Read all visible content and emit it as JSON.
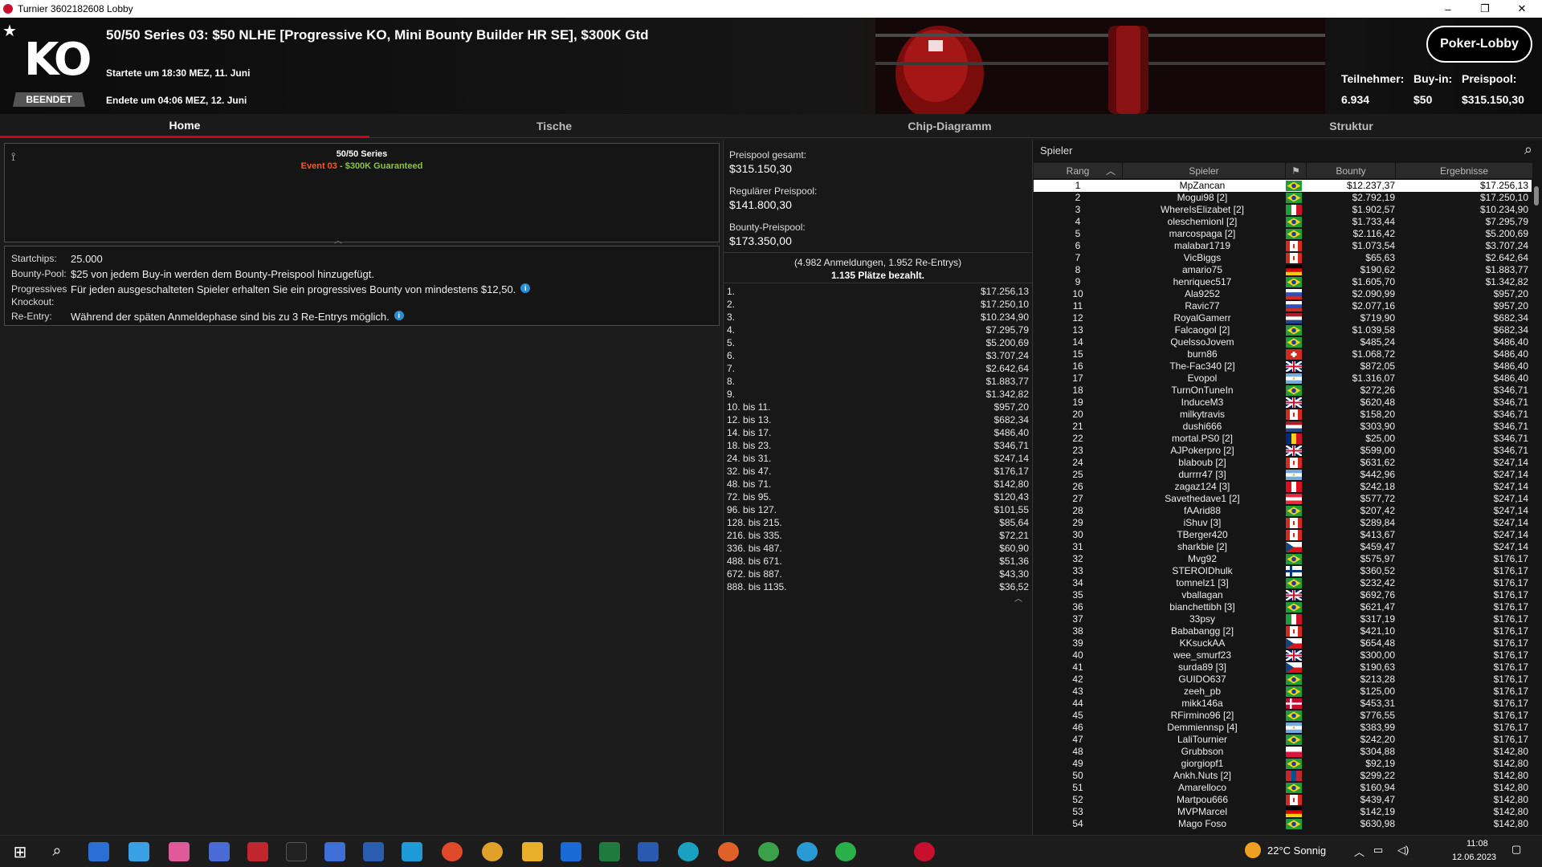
{
  "window": {
    "title": "Turnier 3602182608 Lobby"
  },
  "header": {
    "status_badge": "BEENDET",
    "title": "50/50 Series 03: $50 NLHE [Progressive KO, Mini Bounty Builder HR SE], $300K Gtd",
    "start": "Startete um 18:30 MEZ, 11. Juni",
    "end": "Endete um 04:06 MEZ, 12. Juni",
    "lobby_button": "Poker-Lobby",
    "participants_label": "Teilnehmer:",
    "participants": "6.934",
    "buyin_label": "Buy-in:",
    "buyin": "$50",
    "prizepool_label": "Preispool:",
    "prizepool": "$315.150,30"
  },
  "tabs": [
    "Home",
    "Tische",
    "Chip-Diagramm",
    "Struktur"
  ],
  "series": {
    "title": "50/50 Series",
    "event": "Event 03",
    "dash": " - ",
    "guaranteed": "$300K Guaranteed"
  },
  "details": [
    {
      "k": "Startchips:",
      "v": "25.000",
      "info": false
    },
    {
      "k": "Bounty-Pool:",
      "v": "$25 von jedem Buy-in werden dem Bounty-Preispool hinzugefügt.",
      "info": false
    },
    {
      "k": "Progressives",
      "v": "Für jeden ausgeschalteten Spieler erhalten Sie ein progressives Bounty von mindestens $12,50.",
      "info": true
    },
    {
      "k": "Knockout:",
      "v": "",
      "info": false
    },
    {
      "k": "Re-Entry:",
      "v": "Während der späten Anmeldephase sind bis zu 3 Re-Entrys möglich.",
      "info": true
    }
  ],
  "pool": {
    "total_label": "Preispool gesamt:",
    "total": "$315.150,30",
    "regular_label": "Regulärer Preispool:",
    "regular": "$141.800,30",
    "bounty_label": "Bounty-Preispool:",
    "bounty": "$173.350,00",
    "registrations": "(4.982 Anmeldungen, 1.952 Re-Entrys)",
    "paid": "1.135 Plätze bezahlt."
  },
  "payouts": [
    [
      "1.",
      "$17.256,13"
    ],
    [
      "2.",
      "$17.250,10"
    ],
    [
      "3.",
      "$10.234,90"
    ],
    [
      "4.",
      "$7.295,79"
    ],
    [
      "5.",
      "$5.200,69"
    ],
    [
      "6.",
      "$3.707,24"
    ],
    [
      "7.",
      "$2.642,64"
    ],
    [
      "8.",
      "$1.883,77"
    ],
    [
      "9.",
      "$1.342,82"
    ],
    [
      "10. bis 11.",
      "$957,20"
    ],
    [
      "12. bis 13.",
      "$682,34"
    ],
    [
      "14. bis 17.",
      "$486,40"
    ],
    [
      "18. bis 23.",
      "$346,71"
    ],
    [
      "24. bis 31.",
      "$247,14"
    ],
    [
      "32. bis 47.",
      "$176,17"
    ],
    [
      "48. bis 71.",
      "$142,80"
    ],
    [
      "72. bis 95.",
      "$120,43"
    ],
    [
      "96. bis 127.",
      "$101,55"
    ],
    [
      "128. bis 215.",
      "$85,64"
    ],
    [
      "216. bis 335.",
      "$72,21"
    ],
    [
      "336. bis 487.",
      "$60,90"
    ],
    [
      "488. bis 671.",
      "$51,36"
    ],
    [
      "672. bis 887.",
      "$43,30"
    ],
    [
      "888. bis 1135.",
      "$36,52"
    ]
  ],
  "players_panel": {
    "label": "Spieler",
    "col_rank": "Rang",
    "col_player": "Spieler",
    "col_bounty": "Bounty",
    "col_result": "Ergebnisse"
  },
  "players": [
    [
      "1",
      "MpZancan",
      "$12.237,37",
      "$17.256,13",
      "br"
    ],
    [
      "2",
      "Mogui98 [2]",
      "$2.792,19",
      "$17.250,10",
      "br"
    ],
    [
      "3",
      "WhereIsElizabet [2]",
      "$1.902,57",
      "$10.234,90",
      "mx"
    ],
    [
      "4",
      "oleschemionl [2]",
      "$1.733,44",
      "$7.295,79",
      "br"
    ],
    [
      "5",
      "marcospaga [2]",
      "$2.116,42",
      "$5.200,69",
      "br"
    ],
    [
      "6",
      "malabar1719",
      "$1.073,54",
      "$3.707,24",
      "ca"
    ],
    [
      "7",
      "VicBiggs",
      "$65,63",
      "$2.642,64",
      "ca"
    ],
    [
      "8",
      "amario75",
      "$190,62",
      "$1.883,77",
      "de"
    ],
    [
      "9",
      "henriquec517",
      "$1.605,70",
      "$1.342,82",
      "br"
    ],
    [
      "10",
      "Ala9252",
      "$2.090,99",
      "$957,20",
      "ru"
    ],
    [
      "11",
      "Ravic77",
      "$2.077,16",
      "$957,20",
      "ru"
    ],
    [
      "12",
      "RoyalGamerr",
      "$719,90",
      "$682,34",
      "nl"
    ],
    [
      "13",
      "Falcaogol [2]",
      "$1.039,58",
      "$682,34",
      "br"
    ],
    [
      "14",
      "QuelssoJovem",
      "$485,24",
      "$486,40",
      "br"
    ],
    [
      "15",
      "burn86",
      "$1.068,72",
      "$486,40",
      "ch"
    ],
    [
      "16",
      "The-Fac340 [2]",
      "$872,05",
      "$486,40",
      "gb"
    ],
    [
      "17",
      "Evopol",
      "$1.316,07",
      "$486,40",
      "ar"
    ],
    [
      "18",
      "TurnOnTuneIn",
      "$272,26",
      "$346,71",
      "br"
    ],
    [
      "19",
      "InduceM3",
      "$620,48",
      "$346,71",
      "gb"
    ],
    [
      "20",
      "milkytravis",
      "$158,20",
      "$346,71",
      "ca"
    ],
    [
      "21",
      "dushi666",
      "$303,90",
      "$346,71",
      "nl"
    ],
    [
      "22",
      "mortal.PS0 [2]",
      "$25,00",
      "$346,71",
      "ro"
    ],
    [
      "23",
      "AJPokerpro [2]",
      "$599,00",
      "$346,71",
      "gb"
    ],
    [
      "24",
      "blaboub [2]",
      "$631,62",
      "$247,14",
      "ca"
    ],
    [
      "25",
      "durrrr47 [3]",
      "$442,96",
      "$247,14",
      "ar"
    ],
    [
      "26",
      "zagaz124 [3]",
      "$242,18",
      "$247,14",
      "pe"
    ],
    [
      "27",
      "Savethedave1 [2]",
      "$577,72",
      "$247,14",
      "at"
    ],
    [
      "28",
      "fAArid88",
      "$207,42",
      "$247,14",
      "br"
    ],
    [
      "29",
      "iShuv [3]",
      "$289,84",
      "$247,14",
      "ca"
    ],
    [
      "30",
      "TBerger420",
      "$413,67",
      "$247,14",
      "ca"
    ],
    [
      "31",
      "sharkbie [2]",
      "$459,47",
      "$247,14",
      "cz"
    ],
    [
      "32",
      "Mvg92",
      "$575,97",
      "$176,17",
      "br"
    ],
    [
      "33",
      "STEROIDhulk",
      "$360,52",
      "$176,17",
      "fi"
    ],
    [
      "34",
      "tomnelz1 [3]",
      "$232,42",
      "$176,17",
      "br"
    ],
    [
      "35",
      "vballagan",
      "$692,76",
      "$176,17",
      "gb"
    ],
    [
      "36",
      "bianchettibh [3]",
      "$621,47",
      "$176,17",
      "br"
    ],
    [
      "37",
      "33psy",
      "$317,19",
      "$176,17",
      "it"
    ],
    [
      "38",
      "Bababangg [2]",
      "$421,10",
      "$176,17",
      "ca"
    ],
    [
      "39",
      "KKsuckAA",
      "$654,48",
      "$176,17",
      "cz"
    ],
    [
      "40",
      "wee_smurf23",
      "$300,00",
      "$176,17",
      "gb"
    ],
    [
      "41",
      "surda89 [3]",
      "$190,63",
      "$176,17",
      "cz"
    ],
    [
      "42",
      "GUIDO637",
      "$213,28",
      "$176,17",
      "br"
    ],
    [
      "43",
      "zeeh_pb",
      "$125,00",
      "$176,17",
      "br"
    ],
    [
      "44",
      "mikk146a",
      "$453,31",
      "$176,17",
      "dk"
    ],
    [
      "45",
      "RFirmino96 [2]",
      "$776,55",
      "$176,17",
      "br"
    ],
    [
      "46",
      "Demmiennsp [4]",
      "$383,99",
      "$176,17",
      "ar"
    ],
    [
      "47",
      "LaliTournier",
      "$242,20",
      "$176,17",
      "br"
    ],
    [
      "48",
      "Grubbson",
      "$304,88",
      "$142,80",
      "pl"
    ],
    [
      "49",
      "giorgiopf1",
      "$92,19",
      "$142,80",
      "br"
    ],
    [
      "50",
      "Ankh.Nuts [2]",
      "$299,22",
      "$142,80",
      "mn"
    ],
    [
      "51",
      "Amarelloco",
      "$160,94",
      "$142,80",
      "br"
    ],
    [
      "52",
      "Martpou666",
      "$439,47",
      "$142,80",
      "ca"
    ],
    [
      "53",
      "MVPMarcel",
      "$142,19",
      "$142,80",
      "de"
    ],
    [
      "54",
      "Mago Foso",
      "$630,98",
      "$142,80",
      "br"
    ]
  ],
  "taskbar": {
    "weather": "22°C  Sonnig",
    "time": "11:08",
    "date": "12.06.2023"
  },
  "colors": {
    "accent": "#d0021b",
    "guaranteed": "#8bc34a",
    "event": "#ff5722"
  }
}
